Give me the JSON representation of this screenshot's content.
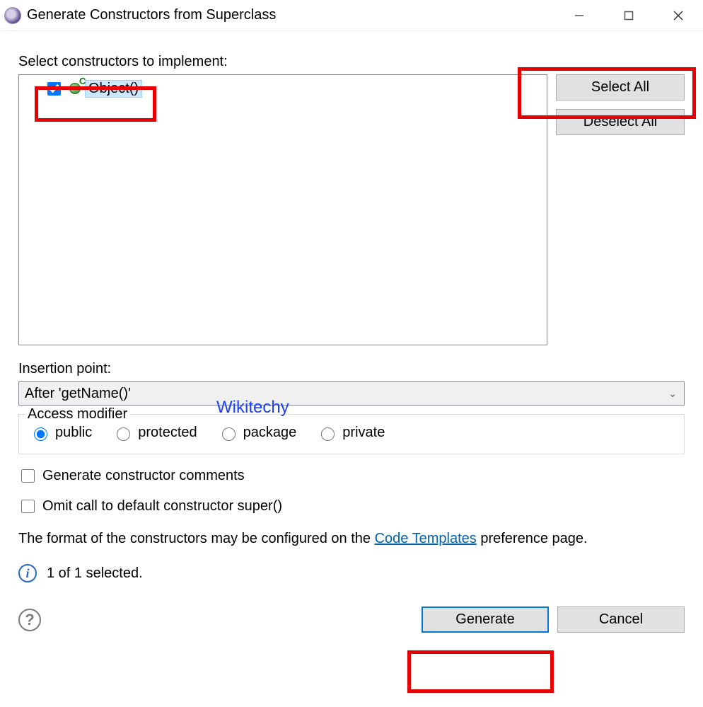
{
  "window": {
    "title": "Generate Constructors from Superclass"
  },
  "main": {
    "select_label": "Select constructors to implement:",
    "tree": {
      "item_label": "Object()",
      "checked": true
    },
    "buttons": {
      "select_all": "Select All",
      "deselect_all": "Deselect All"
    },
    "insertion_label": "Insertion point:",
    "insertion_value": "After 'getName()'",
    "access_modifier": {
      "legend": "Access modifier",
      "options": [
        "public",
        "protected",
        "package",
        "private"
      ],
      "selected": "public"
    },
    "checkboxes": {
      "comments": "Generate constructor comments",
      "omit_super": "Omit call to default constructor super()"
    },
    "format_prefix": "The format of the constructors may be configured on the ",
    "format_link": "Code Templates",
    "format_suffix": " preference page.",
    "status": "1 of 1 selected."
  },
  "footer": {
    "generate": "Generate",
    "cancel": "Cancel"
  },
  "watermark": "Wikitechy"
}
